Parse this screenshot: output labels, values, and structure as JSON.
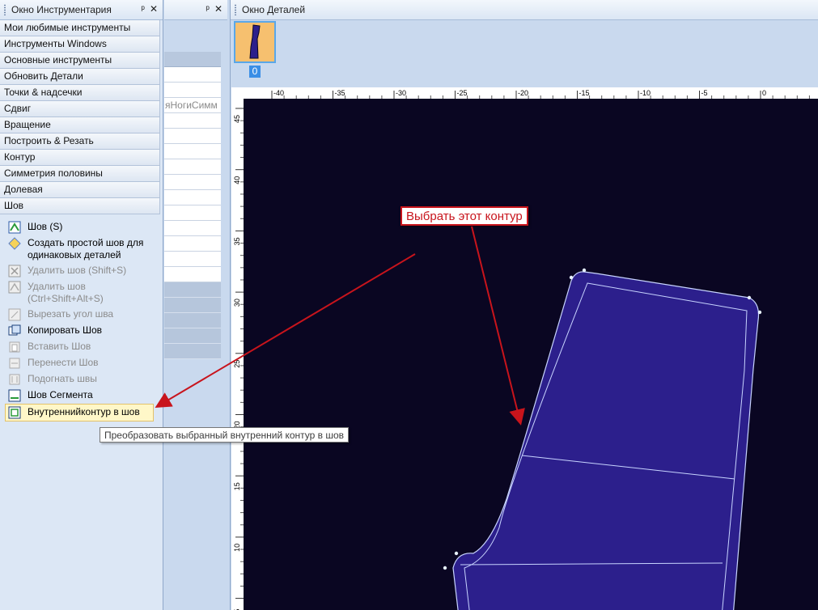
{
  "toolbox": {
    "title": "Окно Инструментария",
    "pin": "ᵖ",
    "close": "✕",
    "categories": [
      "Мои любимые инструменты",
      "Инструменты Windows",
      "Основные инструменты",
      "Обновить Детали",
      "Точки & надсечки",
      "Сдвиг",
      "Вращение",
      "Построить & Резать",
      "Контур",
      "Симметрия половины",
      "Долевая",
      "Шов"
    ],
    "tools": [
      {
        "label": "Шов (S)",
        "icon": "seam-icon",
        "enabled": true
      },
      {
        "label": "Создать простой шов для одинаковых деталей",
        "icon": "diamond-icon",
        "enabled": true
      },
      {
        "label": "Удалить шов (Shift+S)",
        "icon": "delete-seam-icon",
        "enabled": false
      },
      {
        "label": "Удалить шов (Ctrl+Shift+Alt+S)",
        "icon": "delete-seam-all-icon",
        "enabled": false
      },
      {
        "label": "Вырезать угол шва",
        "icon": "cut-corner-icon",
        "enabled": false
      },
      {
        "label": "Копировать Шов",
        "icon": "copy-seam-icon",
        "enabled": true
      },
      {
        "label": "Вставить Шов",
        "icon": "paste-seam-icon",
        "enabled": false
      },
      {
        "label": "Перенести Шов",
        "icon": "move-seam-icon",
        "enabled": false
      },
      {
        "label": "Подогнать швы",
        "icon": "fit-seams-icon",
        "enabled": false
      },
      {
        "label": "Шов Сегмента",
        "icon": "segment-seam-icon",
        "enabled": true
      },
      {
        "label": "Внутреннийконтур в шов",
        "icon": "inner-contour-icon",
        "enabled": true,
        "selected": true
      }
    ]
  },
  "middle": {
    "pin": "ᵖ",
    "close": "✕",
    "row_text": "яНогиСимм"
  },
  "details": {
    "title": "Окно Деталей",
    "thumb_number": "0",
    "ruler_top_labels": [
      "-40",
      "-35",
      "-30",
      "-25",
      "-20",
      "-15",
      "-10",
      "-5",
      "0"
    ],
    "ruler_left_labels": [
      "45",
      "40",
      "35",
      "30",
      "25",
      "20",
      "15",
      "10",
      "5"
    ]
  },
  "tooltip": "Преобразовать выбранный внутренний контур в шов",
  "callout": "Выбрать этот контур",
  "colors": {
    "canvas": "#0a0622",
    "piece": "#2c1f8c",
    "callout": "#c8141c"
  }
}
